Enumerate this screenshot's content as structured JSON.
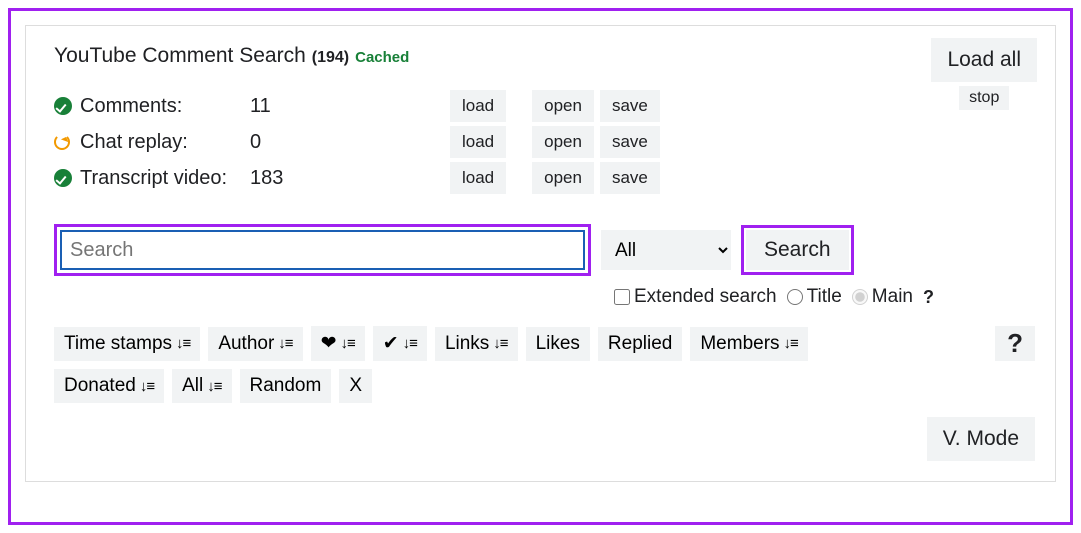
{
  "header": {
    "title": "YouTube Comment Search",
    "count": "(194)",
    "cached": "Cached"
  },
  "top_buttons": {
    "load_all": "Load all",
    "stop": "stop"
  },
  "stats": [
    {
      "icon": "ok",
      "label": "Comments:",
      "value": "11",
      "load": "load",
      "open": "open",
      "save": "save"
    },
    {
      "icon": "reload",
      "label": "Chat replay:",
      "value": "0",
      "load": "load",
      "open": "open",
      "save": "save"
    },
    {
      "icon": "ok",
      "label": "Transcript video:",
      "value": "183",
      "load": "load",
      "open": "open",
      "save": "save"
    }
  ],
  "search": {
    "placeholder": "Search",
    "dropdown_selected": "All",
    "button": "Search"
  },
  "options": {
    "extended": "Extended search",
    "title": "Title",
    "main": "Main",
    "q": "?"
  },
  "sort": {
    "timestamps": "Time stamps",
    "author": "Author",
    "links": "Links",
    "likes": "Likes",
    "replied": "Replied",
    "members": "Members",
    "donated": "Donated",
    "all": "All",
    "random": "Random",
    "x": "X"
  },
  "help": "?",
  "vmode": "V. Mode"
}
